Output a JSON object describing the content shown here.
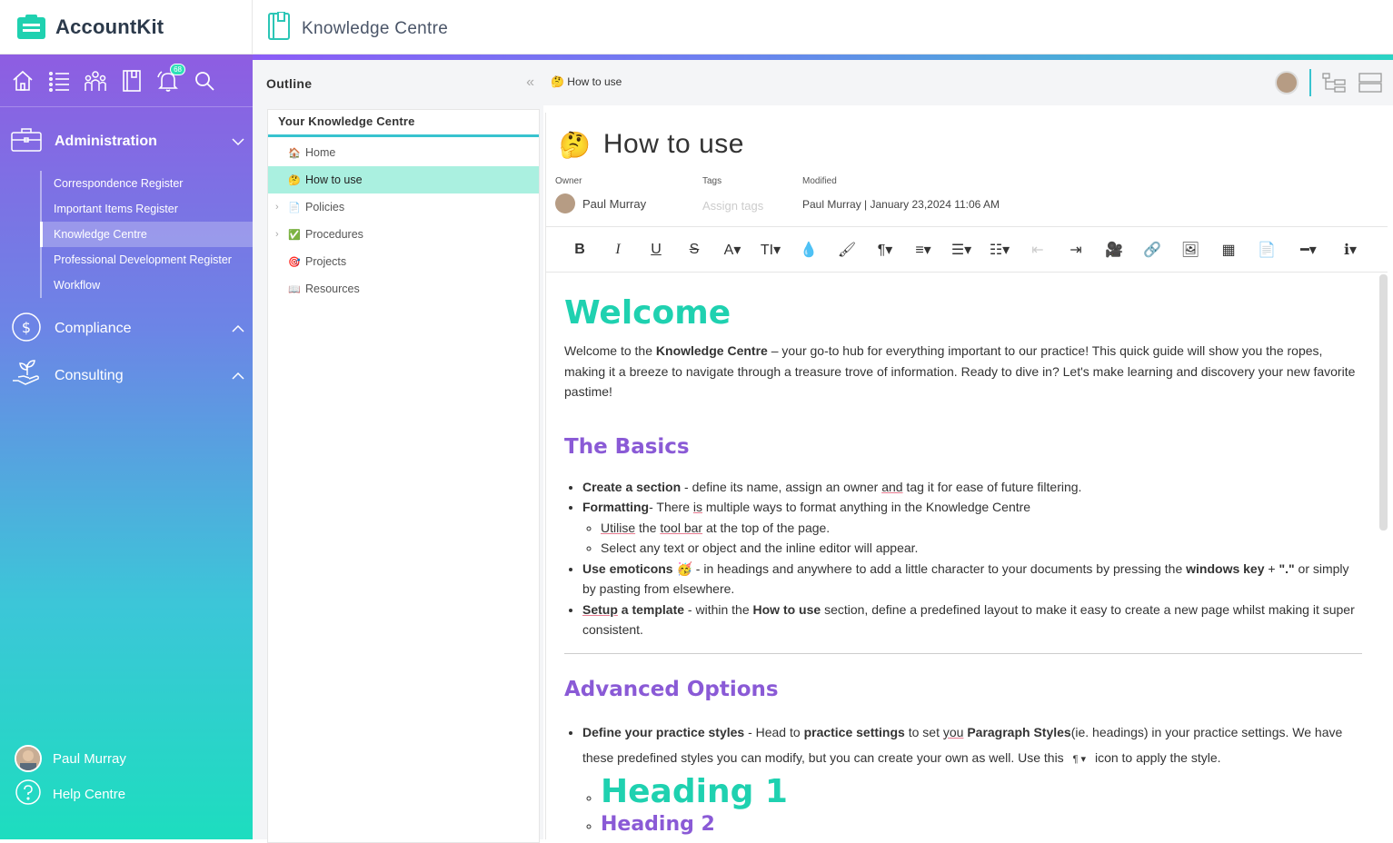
{
  "app": {
    "name": "AccountKit",
    "section_title": "Knowledge Centre",
    "notifications_badge": "68"
  },
  "sidebar": {
    "administration": {
      "label": "Administration",
      "items": [
        {
          "label": "Correspondence Register"
        },
        {
          "label": "Important Items Register"
        },
        {
          "label": "Knowledge Centre"
        },
        {
          "label": "Professional Development Register"
        },
        {
          "label": "Workflow"
        }
      ]
    },
    "compliance": {
      "label": "Compliance"
    },
    "consulting": {
      "label": "Consulting"
    },
    "user": {
      "label": "Paul Murray"
    },
    "help": {
      "label": "Help Centre"
    }
  },
  "outline": {
    "title": "Outline",
    "root": "Your Knowledge Centre",
    "items": [
      {
        "label": "Home",
        "emoji": "🏠"
      },
      {
        "label": "How to use",
        "emoji": "🤔"
      },
      {
        "label": "Policies",
        "emoji": "📄"
      },
      {
        "label": "Procedures",
        "emoji": "✅"
      },
      {
        "label": "Projects",
        "emoji": "🎯"
      },
      {
        "label": "Resources",
        "emoji": "📖"
      }
    ]
  },
  "breadcrumb": {
    "emoji": "🤔",
    "label": "How to use"
  },
  "doc": {
    "emoji": "🤔",
    "title": "How to use",
    "owner_label": "Owner",
    "owner": "Paul Murray",
    "tags_label": "Tags",
    "tags_placeholder": "Assign tags",
    "modified_label": "Modified",
    "modified": "Paul Murray | January 23,2024 11:06 AM"
  },
  "toolbar": [
    "B",
    "I",
    "U",
    "S",
    "A▾",
    "TI▾",
    "💧",
    "🖌",
    "¶▾",
    "≡▾",
    "☰▾",
    "☷▾",
    "⇤",
    "⇥",
    "🎥",
    "🔗",
    "🖼",
    "▦",
    "📄",
    "━▾",
    "ℹ▾"
  ],
  "content": {
    "h_welcome": "Welcome",
    "intro_pre": "Welcome to the ",
    "intro_bold": "Knowledge Centre",
    "intro_post": " – your go-to hub for everything important to our practice! This quick guide will show you the ropes, making it a breeze to navigate through a treasure trove of information. Ready to dive in? Let's make learning and discovery your new favorite pastime!",
    "h_basics": "The Basics",
    "b1_bold": "Create a section",
    "b1_pre": " - define its name, assign an owner ",
    "b1_u": "and",
    "b1_post": " tag it for ease of future filtering.",
    "b2_bold": "Formatting",
    "b2_pre": "- There ",
    "b2_u": "is",
    "b2_post": " multiple ways to format anything in the Knowledge Centre",
    "b2a_u1": "Utilise",
    "b2a_mid": " the ",
    "b2a_u2": "tool bar",
    "b2a_post": " at the top of the page.",
    "b2b": "Select any text or object and the inline editor will appear.",
    "b3_bold": "Use emoticons",
    "b3_emoji": "🥳",
    "b3_pre": " - in headings and anywhere to add a little character to your documents by pressing the ",
    "b3_bold2": "windows key",
    "b3_mid": " + ",
    "b3_bold3": "\".\"",
    "b3_post": " or simply by pasting from elsewhere.",
    "b4_u": "Setup",
    "b4_bold": " a template",
    "b4_pre": " - within the ",
    "b4_bold2": "How to use",
    "b4_post": " section, define a predefined layout to make it easy to create a new page whilst making it super consistent.",
    "h_advanced": "Advanced Options",
    "a1_bold": "Define your practice styles",
    "a1_pre": " - Head to ",
    "a1_bold2": "practice settings",
    "a1_mid": " to set ",
    "a1_u": "you",
    "a1_bold3": " Paragraph Styles",
    "a1_post": "(ie. headings) in your practice settings. We have these predefined styles you can modify, but you can create your own as well. Use this ",
    "a1_icon": "¶ ▾",
    "a1_end": " icon to apply the style.",
    "sample_h1": "Heading 1",
    "sample_h2": "Heading 2"
  }
}
